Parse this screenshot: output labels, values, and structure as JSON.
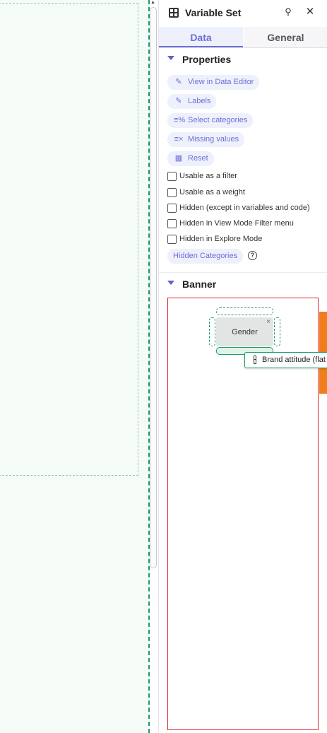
{
  "panel": {
    "title": "Variable Set",
    "pin_icon": "pin-icon",
    "close_icon": "close-icon"
  },
  "tabs": [
    {
      "label": "Data",
      "active": true
    },
    {
      "label": "General",
      "active": false
    }
  ],
  "properties": {
    "heading": "Properties",
    "actions": [
      {
        "label": "View in Data Editor",
        "icon": "pencil-icon"
      },
      {
        "label": "Labels",
        "icon": "pencil-icon"
      },
      {
        "label": "Select categories",
        "icon": "select-categories-icon"
      },
      {
        "label": "Missing values",
        "icon": "missing-values-icon"
      },
      {
        "label": "Reset",
        "icon": "reset-icon"
      }
    ],
    "checkboxes": [
      {
        "label": "Usable as a filter",
        "checked": false
      },
      {
        "label": "Usable as a weight",
        "checked": false
      },
      {
        "label": "Hidden (except in variables and code)",
        "checked": false
      },
      {
        "label": "Hidden in View Mode Filter menu",
        "checked": false
      },
      {
        "label": "Hidden in Explore Mode",
        "checked": false
      }
    ],
    "hidden_categories_label": "Hidden Categories",
    "help_glyph": "?"
  },
  "banner": {
    "heading": "Banner",
    "chip_label": "Gender",
    "chip_close": "×",
    "dragging_label": "Brand attitude (flat"
  },
  "colors": {
    "accent": "#6c6fd8",
    "drop_zone": "#1f9a68",
    "banner_border": "#d9262c",
    "drag_preview": "#f07e1c"
  }
}
